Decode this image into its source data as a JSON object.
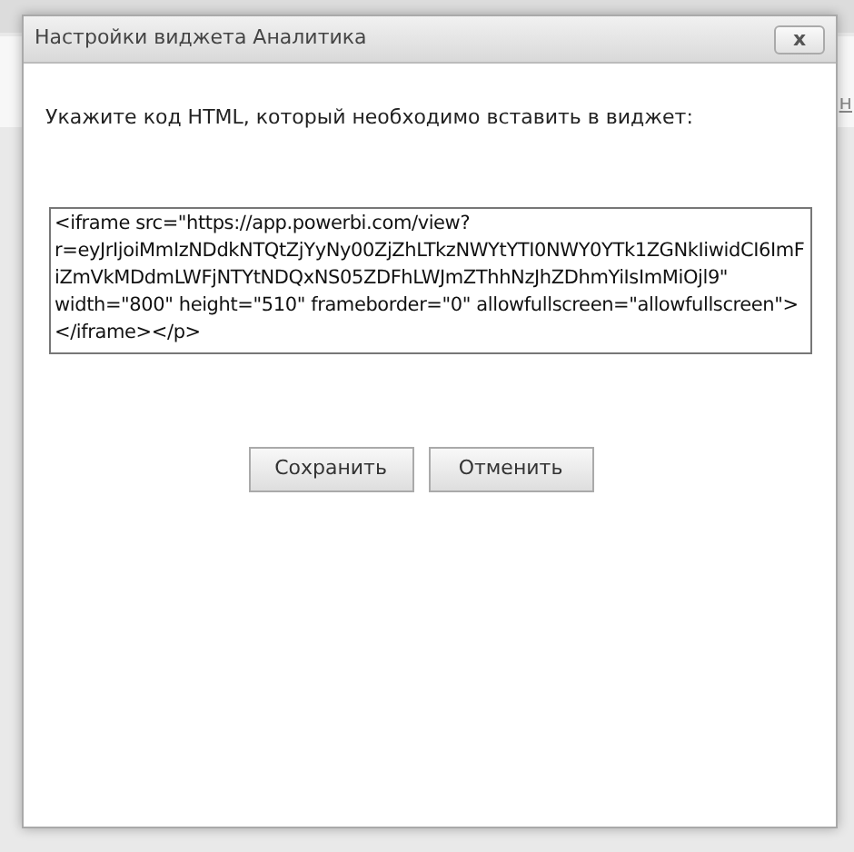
{
  "background": {
    "link": "н"
  },
  "dialog": {
    "title": "Настройки виджета Аналитика",
    "close": "x",
    "prompt": "Укажите код HTML, который необходимо вставить в виджет:",
    "code": "<iframe src=\"https://app.powerbi.com/view?r=eyJrIjoiMmIzNDdkNTQtZjYyNy00ZjZhLTkzNWYtYTI0NWY0YTk1ZGNkIiwidCI6ImFiZmVkMDdmLWFjNTYtNDQxNS05ZDFhLWJmZThhNzJhZDhmYiIsImMiOjl9\" width=\"800\" height=\"510\" frameborder=\"0\" allowfullscreen=\"allowfullscreen\"></iframe></p>",
    "buttons": [
      "Сохранить",
      "Отменить"
    ]
  }
}
